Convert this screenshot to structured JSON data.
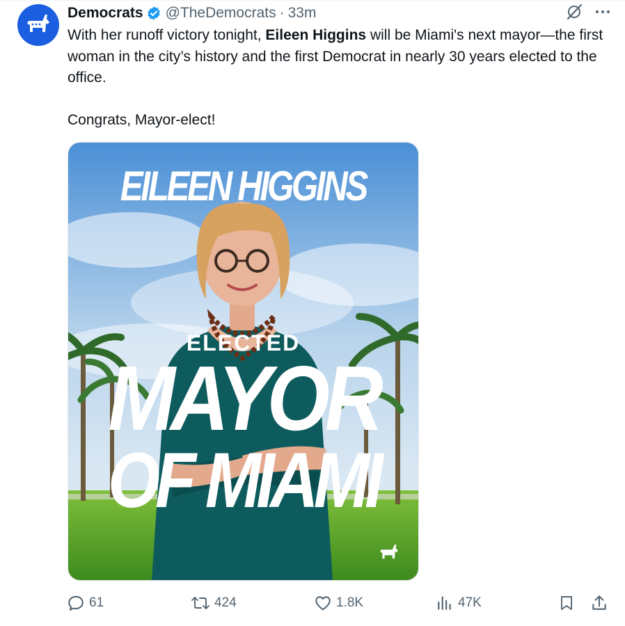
{
  "tweet": {
    "display_name": "Democrats",
    "handle": "@TheDemocrats",
    "separator": "·",
    "time": "33m",
    "text_intro": "With her runoff victory tonight, ",
    "text_bold": "Eileen Higgins",
    "text_rest": " will be Miami's next mayor—the first woman in the city’s history and the first Democrat in nearly 30 years elected to the office.",
    "text_line2": "Congrats, Mayor-elect!"
  },
  "poster": {
    "name": "EILEEN HIGGINS",
    "elected": "ELECTED",
    "line1": "MAYOR",
    "line2": "OF MIAMI"
  },
  "actions": {
    "replies": "61",
    "reposts": "424",
    "likes": "1.8K",
    "views": "47K"
  },
  "icons": {
    "avatar": "donkey-logo-icon",
    "verified": "verified-badge-icon",
    "grok": "grok-icon",
    "more": "more-icon",
    "reply": "reply-icon",
    "repost": "repost-icon",
    "like": "heart-icon",
    "views": "views-icon",
    "bookmark": "bookmark-icon",
    "share": "share-icon"
  },
  "colors": {
    "brand": "#1b5fe0",
    "verified": "#1d9bf0",
    "text": "#0f1419",
    "muted": "#536471"
  }
}
